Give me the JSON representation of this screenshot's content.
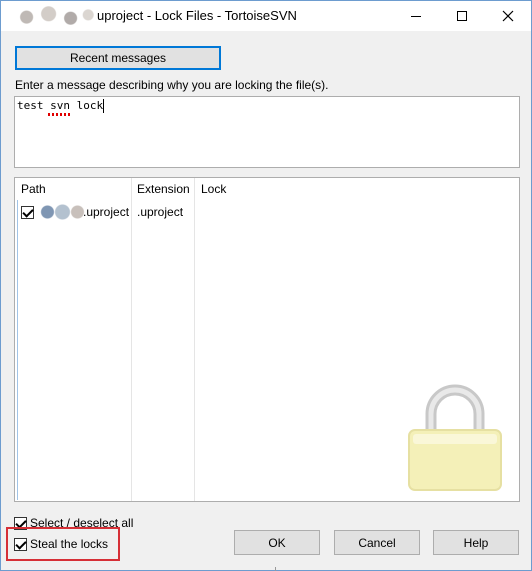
{
  "window": {
    "title": "uproject - Lock Files - TortoiseSVN"
  },
  "toolbar": {
    "recent_messages_label": "Recent messages"
  },
  "message": {
    "prompt": "Enter a message describing why you are locking the file(s).",
    "value": "test svn lock"
  },
  "file_list": {
    "columns": [
      "Path",
      "Extension",
      "Lock"
    ],
    "rows": [
      {
        "checked": true,
        "path": ".uproject",
        "extension": ".uproject",
        "lock": ""
      }
    ]
  },
  "options": {
    "select_all_label": "Select / deselect all",
    "select_all_checked": true,
    "steal_locks_label": "Steal the locks",
    "steal_locks_checked": true
  },
  "buttons": {
    "ok": "OK",
    "cancel": "Cancel",
    "help": "Help"
  },
  "colors": {
    "accent": "#0078d7",
    "highlight": "#d62f36",
    "lock_body": "#f4f0b8"
  },
  "icons": [
    "app-icon",
    "minimize-icon",
    "maximize-icon",
    "close-icon",
    "checkbox-icon",
    "padlock-icon"
  ]
}
